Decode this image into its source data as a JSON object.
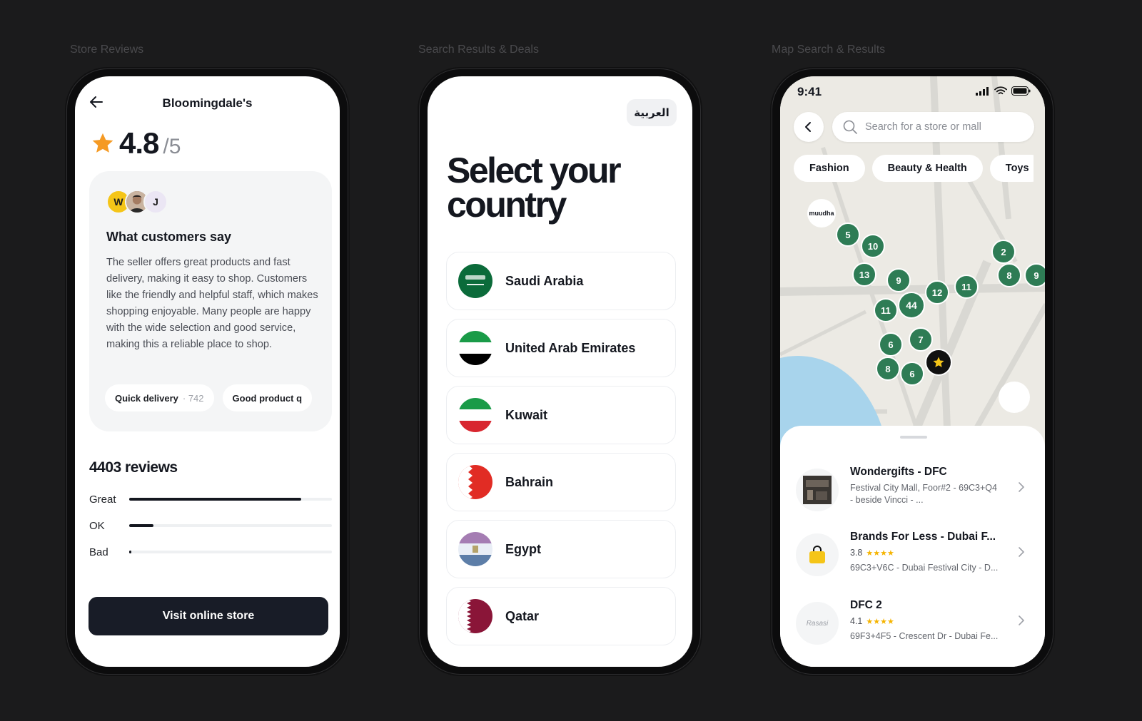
{
  "labels": {
    "store_reviews": "Store Reviews",
    "search_results": "Search Results & Deals",
    "map_search": "Map Search & Results"
  },
  "reviews_screen": {
    "title": "Bloomingdale's",
    "rating": "4.8",
    "rating_max": "/5",
    "avatars": [
      "W",
      "J"
    ],
    "card_title": "What customers say",
    "card_text": "The seller offers great products and fast delivery, making it easy to shop. Customers like the friendly and helpful staff, which makes shopping enjoyable. Many people are happy with the wide selection and good service, making this a reliable place to shop.",
    "tags": [
      {
        "label": "Quick delivery",
        "count": "· 742"
      },
      {
        "label": "Good product q",
        "count": ""
      }
    ],
    "reviews_count": "4403 reviews",
    "breakdown": [
      {
        "label": "Great",
        "fraction": 0.85
      },
      {
        "label": "OK",
        "fraction": 0.12
      },
      {
        "label": "Bad",
        "fraction": 0.01
      }
    ],
    "cta": "Visit online store"
  },
  "country_screen": {
    "language_button": "العربية",
    "title": "Select your country",
    "countries": [
      "Saudi Arabia",
      "United Arab Emirates",
      "Kuwait",
      "Bahrain",
      "Egypt",
      "Qatar"
    ]
  },
  "map_screen": {
    "time": "9:41",
    "search_placeholder": "Search for a store or mall",
    "chips": [
      "Fashion",
      "Beauty & Health",
      "Toys"
    ],
    "map_badge": "muudha",
    "clusters": [
      "5",
      "10",
      "13",
      "9",
      "2",
      "8",
      "9",
      "12",
      "11",
      "11",
      "44",
      "6",
      "7",
      "8",
      "6"
    ],
    "stores": [
      {
        "name": "Wondergifts - DFC",
        "line1": "Festival City Mall, Foor#2 - 69C3+Q4",
        "line2": "- beside Vincci - ..."
      },
      {
        "name": "Brands For Less - Dubai F...",
        "rating": "3.8",
        "stars": "★★★★",
        "address": "69C3+V6C - Dubai Festival City - D..."
      },
      {
        "name": "DFC 2",
        "rating": "4.1",
        "stars": "★★★★",
        "address": "69F3+4F5 - Crescent Dr - Dubai Fe...",
        "thumb_text": "Rasasi"
      }
    ],
    "accent_color": "#2e7c55"
  }
}
